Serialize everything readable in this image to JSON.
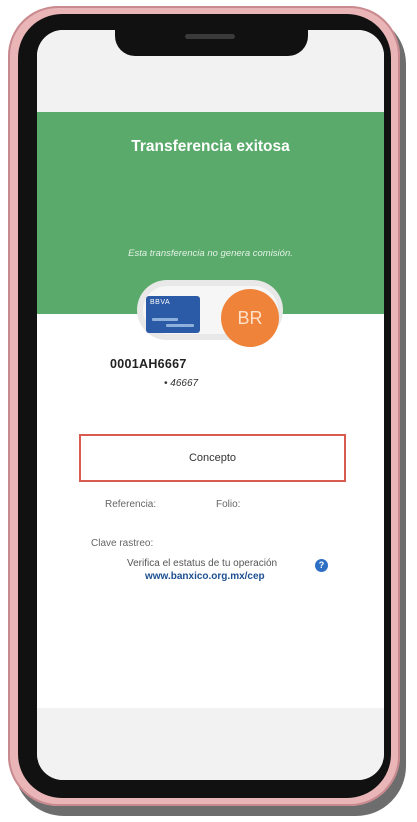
{
  "header": {
    "title": "Transferencia exitosa",
    "subtitle": "Esta transferencia no genera comisión."
  },
  "card": {
    "brand": "BBVA"
  },
  "recipient": {
    "initials": "BR",
    "account_name": "0001AH6667",
    "account_mask": "• 46667"
  },
  "concept": {
    "label": "Concepto"
  },
  "details": {
    "referencia_label": "Referencia:",
    "folio_label": "Folio:",
    "clave_label": "Clave rastreo:"
  },
  "verify": {
    "text": "Verifica el estatus de tu operación",
    "link": "www.banxico.org.mx/cep",
    "help_icon": "?"
  },
  "colors": {
    "success_green": "#5aaa6b",
    "avatar_orange": "#f0833a",
    "card_blue": "#2b5aa6",
    "highlight_red": "#d95b4f",
    "link_blue": "#1d4f91",
    "frame_pink": "#e9b5b7"
  }
}
